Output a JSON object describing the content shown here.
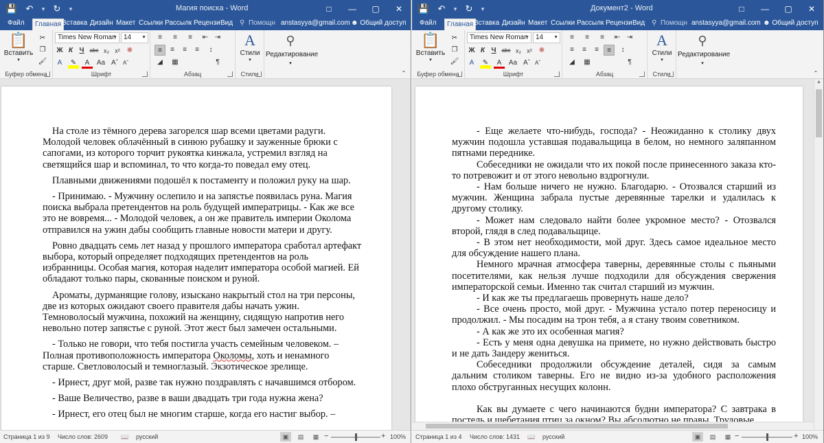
{
  "windows": [
    {
      "title": "Магия поиска - Word",
      "tabs": [
        "Файл",
        "Главная",
        "Вставка",
        "Дизайн",
        "Макет",
        "Ссылки",
        "Рассылк",
        "Рецензи",
        "Вид"
      ],
      "help": "Помощн",
      "user": "anstasyya@gmail.com",
      "share": "Общий доступ",
      "font_name": "Times New Roman",
      "font_size": "14",
      "paste_label": "Вставить",
      "styles_label": "Стили",
      "editing_label": "Редактирование",
      "groups": {
        "clipboard": "Буфер обмена",
        "font": "Шрифт",
        "paragraph": "Абзац",
        "styles": "Стили"
      },
      "paragraphs": [
        "На столе из тёмного дерева загорелся шар всеми цветами радуги. Молодой человек облачённый в синюю рубашку и зауженные брюки с сапогами, из которого торчит рукоятка кинжала, устремил взгляд на светящийся шар и вспоминал, то что когда-то поведал ему отец.",
        "Плавными движениями подошёл к постаменту и положил руку на шар.",
        "- Принимаю. - Мужчину ослепило и на запястье появилась руна. Магия поиска выбрала претендентов на роль будущей императрицы. - Как же все это не вовремя... - Молодой человек, а он же правитель империи Околома отправился на ужин дабы сообщить главные новости матери и другу.",
        "Ровно двадцать семь лет назад у прошлого императора сработал артефакт выбора, который определяет подходящих претендентов на роль избранницы. Особая магия, которая наделит императора особой магией. Ей обладают только пары, скованные поиском и руной.",
        "Ароматы, дурманящие голову, изыскано накрытый стол на три персоны, две из которых ожидают своего правителя дабы начать ужин. Темноволосый мужчина, похожий на женщину, сидящую напротив него невольно потер запястье с руной. Этот жест был замечен остальными.",
        "- Только не говори, что тебя постигла участь семейным человеком. – Полная противоположность императора",
        "Околомы",
        ", хоть и ненамного старше. Светловолосый и темноглазый. Экзотическое зрелище.",
        "- Ирнест, друг мой, разве так нужно поздравлять с начавшимся отбором.",
        "- Ваше Величество, разве в ваши двадцать три года нужна жена?",
        "- Ирнест, его отец был не многим старше, когда его настиг выбор. –"
      ],
      "status": {
        "page": "Страница 1 из 9",
        "words": "Число слов: 2609",
        "lang": "русский",
        "zoom": "100%"
      }
    },
    {
      "title": "Документ2 - Word",
      "tabs": [
        "Файл",
        "Главная",
        "Вставка",
        "Дизайн",
        "Макет",
        "Ссылки",
        "Рассылк",
        "Рецензи",
        "Вид"
      ],
      "help": "Помощн",
      "user": "anstasyya@gmail.com",
      "share": "Общий доступ",
      "font_name": "Times New Roman",
      "font_size": "14",
      "paste_label": "Вставить",
      "styles_label": "Стили",
      "editing_label": "Редактирование",
      "groups": {
        "clipboard": "Буфер обмена",
        "font": "Шрифт",
        "paragraph": "Абзац",
        "styles": "Стили"
      },
      "paragraphs": [
        "- Еще желаете что-нибудь, господа? - Неожиданно к столику двух мужчин подошла уставшая подавальщица в белом, но немного заляпанном пятнами переднике.",
        "Собеседники не ожидали что их покой после принесенного заказа кто-то потревожит и от этого невольно вздрогнули.",
        "- Нам больше ничего не нужно. Благодарю. - Отозвался старший из мужчин. Женщина забрала пустые деревянные тарелки и удалилась к другому столику.",
        "- Может нам следовало найти более укромное место? - Отозвался второй, глядя в след подавальщице.",
        "- В этом нет необходимости, мой друг. Здесь самое идеальное место для обсуждение нашего плана.",
        "Немного мрачная атмосфера таверны, деревянные столы с пьяными посетителями, как нельзя лучше подходили для обсуждения свержения императорской семьи. Именно так считал старший из мужчин.",
        "- И как же ты предлагаешь провернуть наше дело?",
        "- Все очень просто, мой друг. - Мужчина устало потер переносицу и продолжил. - Мы посадим на трон тебя, а я стану твоим советником.",
        "- А как же это их особенная магия?",
        "- Есть у меня одна девушка на примете, но нужно действовать быстро и не дать Зандеру жениться.",
        "Собеседники продолжили обсуждение деталей, сидя за самым дальним столиком таверны. Его не видно из-за удобного расположения плохо обструганных несущих колонн.",
        "Как вы думаете с чего начинаются будни императора? С завтрака в постель и щебетания птиц за окном? Вы абсолютно не правы. Трудовые"
      ],
      "status": {
        "page": "Страница 1 из 4",
        "words": "Число слов: 1431",
        "lang": "русский",
        "zoom": "100%"
      }
    }
  ]
}
